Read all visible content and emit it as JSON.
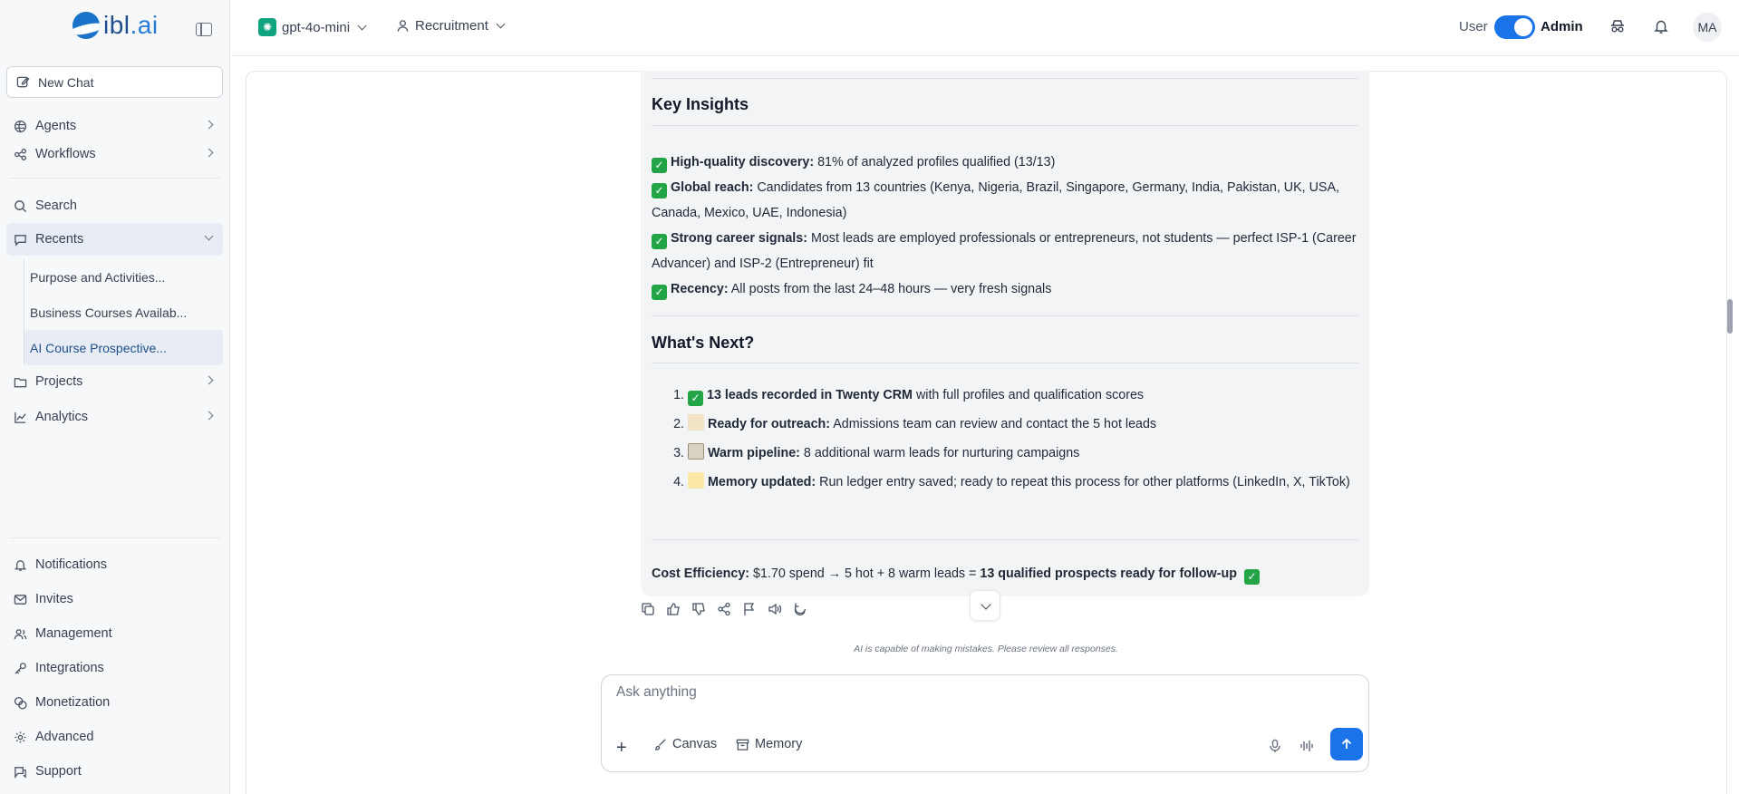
{
  "sidebar": {
    "logo_text": "ibl",
    "logo_suffix": ".ai",
    "new_chat": "New Chat",
    "agents": "Agents",
    "workflows": "Workflows",
    "search": "Search",
    "recents": "Recents",
    "recent_items": [
      "Purpose and Activities...",
      "Business Courses Availab...",
      "AI Course Prospective..."
    ],
    "projects": "Projects",
    "analytics": "Analytics",
    "bottom": [
      "Notifications",
      "Invites",
      "Management",
      "Integrations",
      "Monetization",
      "Advanced",
      "Support"
    ]
  },
  "topbar": {
    "model": "gpt-4o-mini",
    "role": "Recruitment",
    "user_label": "User",
    "admin_label": "Admin",
    "avatar": "MA"
  },
  "message": {
    "insights_title": "Key Insights",
    "insights": [
      {
        "label": "High-quality discovery:",
        "text": " 81% of analyzed profiles qualified (13/13)"
      },
      {
        "label": "Global reach:",
        "text": " Candidates from 13 countries (Kenya, Nigeria, Brazil, Singapore, Germany, India, Pakistan, UK, USA, Canada, Mexico, UAE, Indonesia)"
      },
      {
        "label": "Strong career signals:",
        "text": " Most leads are employed professionals or entrepreneurs, not students — perfect ISP-1 (Career Advancer) and ISP-2 (Entrepreneur) fit"
      },
      {
        "label": "Recency:",
        "text": " All posts from the last 24–48 hours — very fresh signals"
      }
    ],
    "next_title": "What's Next?",
    "next": [
      {
        "label": "13 leads recorded in Twenty CRM",
        "text": " with full profiles and qualification scores"
      },
      {
        "label": "Ready for outreach:",
        "text": " Admissions team can review and contact the 5 hot leads"
      },
      {
        "label": "Warm pipeline:",
        "text": " 8 additional warm leads for nurturing campaigns"
      },
      {
        "label": "Memory updated:",
        "text": " Run ledger entry saved; ready to repeat this process for other platforms (LinkedIn, X, TikTok)"
      }
    ],
    "cost_label": "Cost Efficiency:",
    "cost_text": " $1.70 spend → 5 hot + 8 warm leads = ",
    "cost_strong": "13 qualified prospects ready for follow-up"
  },
  "disclaimer": "AI is capable of making mistakes. Please review all responses.",
  "composer": {
    "placeholder": "Ask anything",
    "canvas": "Canvas",
    "memory": "Memory"
  },
  "colors": {
    "accent": "#1a73e8",
    "check": "#22a447"
  }
}
